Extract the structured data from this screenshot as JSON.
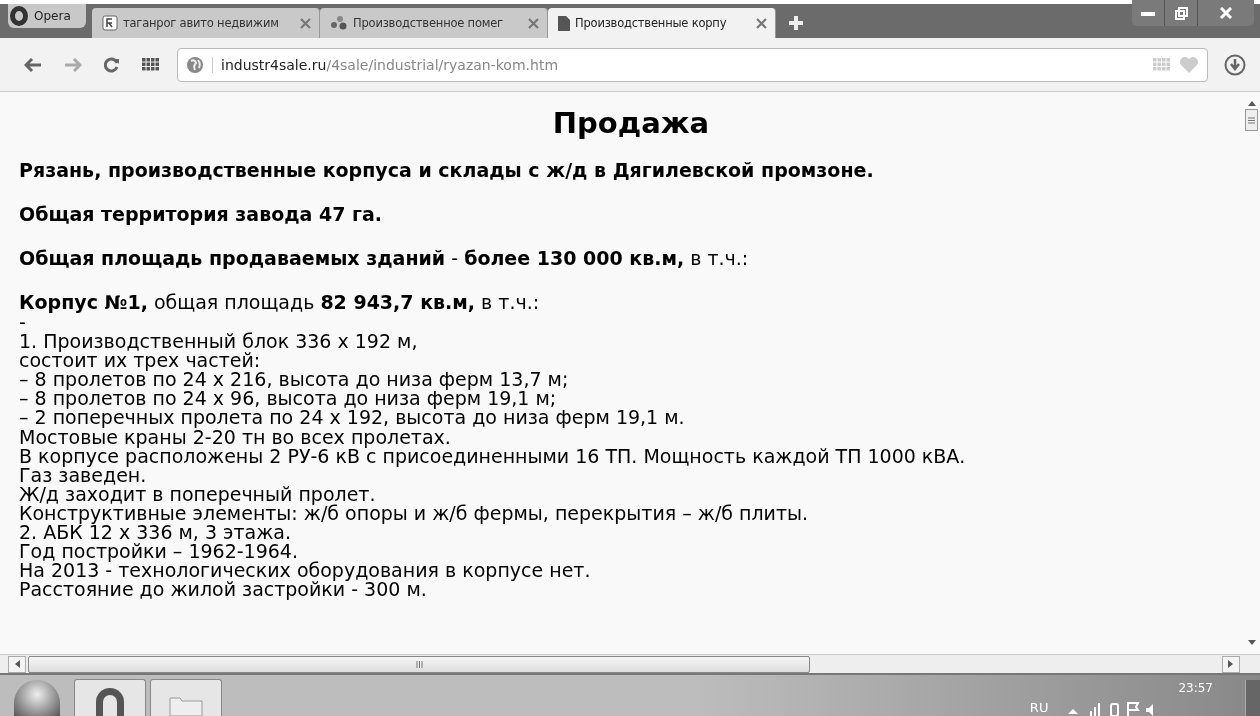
{
  "browser": {
    "menu_label": "Opera",
    "tabs": [
      {
        "title": "таганрог авито недвижим",
        "kind": "yandex",
        "selected": false
      },
      {
        "title": "Производственное помег",
        "kind": "dots",
        "selected": false
      },
      {
        "title": "Производственные корпу",
        "kind": "page",
        "selected": true
      }
    ],
    "address": {
      "domain": "industr4sale.ru",
      "path": "/4sale/industrial/ryazan-kom.htm"
    }
  },
  "page": {
    "heading": "Продажа",
    "paragraphs": [
      "**Рязань, производственные корпуса и склады с ж/д в Дягилевской промзоне.**",
      "**Общая территория завода 47 га.**",
      "**Общая площадь продаваемых зданий** - **более 130 000 кв.м,** в т.ч.:",
      "**Корпус №1,** общая площадь **82 943,7 кв.м,** в т.ч.:"
    ],
    "lines": [
      "-",
      "1. Производственный блок 336 х 192 м,",
      "состоит их трех частей:",
      "– 8 пролетов по 24 х 216, высота до низа ферм 13,7 м;",
      "– 8 пролетов по 24 х 96, высота до низа ферм 19,1 м;",
      "– 2 поперечных пролета по 24 х 192, высота до низа ферм 19,1 м.",
      "Мостовые краны 2-20 тн во всех пролетах.",
      "В корпусе расположены 2 РУ-6 кВ с присоединенными 16 ТП. Мощность каждой ТП 1000 кВА.",
      "Газ заведен.",
      "Ж/д заходит в поперечный пролет.",
      "Конструктивные элементы: ж/б опоры и ж/б фермы, перекрытия – ж/б плиты.",
      "2. АБК 12 х 336 м, 3 этажа.",
      "Год постройки – 1962-1964.",
      "На 2013 - технологических оборудования в корпусе нет.",
      "Расстояние до жилой застройки - 300 м."
    ]
  },
  "taskbar": {
    "language": "RU",
    "clock": "23:57"
  }
}
